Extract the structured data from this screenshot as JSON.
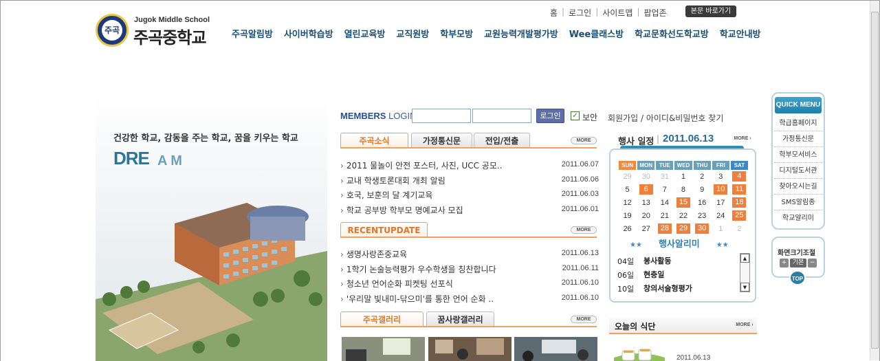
{
  "logo": {
    "seal_text": "주곡",
    "english_name": "Jugok Middle School",
    "korean_name": "주곡중학교"
  },
  "util_links": [
    "홈",
    "로그인",
    "사이트맵",
    "팝업존"
  ],
  "skip_button": "본문 바로가기",
  "gnb": [
    "주곡알림방",
    "사이버학습방",
    "열린교육방",
    "교직원방",
    "학부모방",
    "교원능력개발평가방",
    "Wee클래스방",
    "학교문화선도학교방",
    "학교안내방"
  ],
  "visual": {
    "slogan": "건강한 학교,  감동을 주는 학교, 꿈을 키우는 학교",
    "dream_main": "DRE",
    "dream_tail": "A  M"
  },
  "login": {
    "label_bold": "MEMBERS",
    "label_rest": "LOGIN",
    "button": "로그인",
    "secure_label": "보안",
    "secure_checked": true,
    "join_link": "회원가입 / 아이디&비밀번호 찾기"
  },
  "news": {
    "tabs": [
      "주곡소식",
      "가정통신문",
      "전입/전출"
    ],
    "more": "MORE",
    "items": [
      {
        "title": "2011 물놀이 안전 포스터, 사진, UCC 공모..",
        "date": "2011.06.07"
      },
      {
        "title": "교내 학생토론대회 개최 알림",
        "date": "2011.06.06"
      },
      {
        "title": "호국, 보훈의 달 계기교육",
        "date": "2011.06.03"
      },
      {
        "title": "학교 공부방 학부모 명예교사 모집",
        "date": "2011.06.01"
      }
    ]
  },
  "recent": {
    "tab": "RECENTUPDATE",
    "more": "MORE",
    "items": [
      {
        "title": "생명사랑존중교육",
        "date": "2011.06.13"
      },
      {
        "title": "1학기 논술능력평가 우수학생을 칭찬합니다",
        "date": "2011.06.11"
      },
      {
        "title": "청소년 언어순화 피켓팅 선포식",
        "date": "2011.06.10"
      },
      {
        "title": "'우리말 빛내미-닦으미'를 통한 언어 순화 ..",
        "date": "2011.06.10"
      }
    ]
  },
  "gallery": {
    "tabs": [
      "주곡갤러리",
      "꿈사랑갤러리"
    ],
    "more": "MORE"
  },
  "calendar": {
    "title": "행사 일정",
    "date": "2011.06.13",
    "more": "MORE",
    "weekdays": [
      "SUN",
      "MON",
      "TUE",
      "WED",
      "THU",
      "FRI",
      "SAT"
    ],
    "weeks": [
      [
        [
          "29",
          "dim"
        ],
        [
          "30",
          "dim"
        ],
        [
          "31",
          "dim"
        ],
        [
          "1",
          ""
        ],
        [
          "2",
          ""
        ],
        [
          "3",
          ""
        ],
        [
          "4",
          "ev"
        ]
      ],
      [
        [
          "5",
          ""
        ],
        [
          "6",
          "ev"
        ],
        [
          "7",
          ""
        ],
        [
          "8",
          ""
        ],
        [
          "9",
          ""
        ],
        [
          "10",
          "ev"
        ],
        [
          "11",
          "ev"
        ]
      ],
      [
        [
          "12",
          ""
        ],
        [
          "13",
          ""
        ],
        [
          "14",
          ""
        ],
        [
          "15",
          "ev"
        ],
        [
          "16",
          ""
        ],
        [
          "17",
          ""
        ],
        [
          "18",
          "ev"
        ]
      ],
      [
        [
          "19",
          ""
        ],
        [
          "20",
          ""
        ],
        [
          "21",
          ""
        ],
        [
          "22",
          ""
        ],
        [
          "23",
          ""
        ],
        [
          "24",
          ""
        ],
        [
          "25",
          "ev"
        ]
      ],
      [
        [
          "26",
          ""
        ],
        [
          "27",
          ""
        ],
        [
          "28",
          "ev"
        ],
        [
          "29",
          "ev"
        ],
        [
          "30",
          "ev"
        ],
        [
          "1",
          "dim"
        ],
        [
          "2",
          "dim"
        ]
      ]
    ],
    "events_title": "행사알리미",
    "events": [
      {
        "day": "04일",
        "name": "봉사활동"
      },
      {
        "day": "06일",
        "name": "현충일"
      },
      {
        "day": "10일",
        "name": "창의서술형평가"
      }
    ]
  },
  "meal": {
    "title": "오늘의 식단",
    "more": "MORE",
    "date": "2011.06.13"
  },
  "quick_menu": {
    "title": "QUICK MENU",
    "items": [
      "학급홈페이지",
      "가정통신문",
      "학부모서비스",
      "디지털도서관",
      "찾아오시는길",
      "SMS알림종",
      "학교알리미"
    ],
    "zoom_label": "화면크기조절",
    "zoom_in": "+",
    "zoom_reset": "기본",
    "zoom_out": "−",
    "top": "TOP"
  },
  "colors": {
    "nav_text": "#1b4f72",
    "tab_accent": "#f2a15d",
    "event_highlight": "#f07f3c",
    "calendar_blue": "#2a6b9a"
  }
}
